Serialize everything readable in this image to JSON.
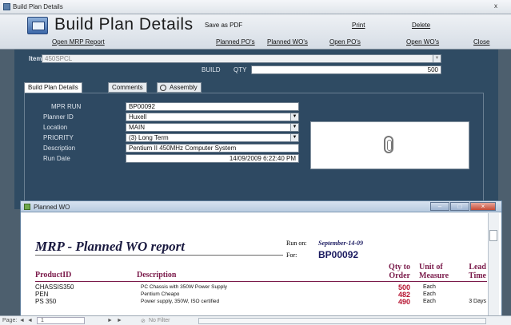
{
  "window": {
    "title": "Build Plan Details",
    "close_glyph": "x"
  },
  "header": {
    "title": "Build Plan Details",
    "top_buttons": [
      "Save as PDF",
      "Print",
      "Delete"
    ],
    "nav_buttons": [
      "Open MRP Report",
      "Planned PO's",
      "Planned WO's",
      "Open PO's",
      "Open WO's",
      "Close"
    ]
  },
  "form": {
    "item_label": "Item",
    "item_value": "450SPCL",
    "build_label": "BUILD",
    "qty_label": "QTY",
    "qty_value": "500",
    "tabs": [
      "Build Plan Details",
      "Comments",
      "Assembly"
    ],
    "fields": [
      {
        "label": "MPR RUN",
        "value": "BP00092",
        "dropdown": false
      },
      {
        "label": "Planner ID",
        "value": "Huxell",
        "dropdown": true
      },
      {
        "label": "Location",
        "value": "MAIN",
        "dropdown": true
      },
      {
        "label": "PRIORITY",
        "value": "(3) Long Term",
        "dropdown": true
      },
      {
        "label": "Description",
        "value": "Pentium II 450MHz Computer System",
        "dropdown": false
      },
      {
        "label": "Run Date",
        "value": "14/09/2009 6:22:40 PM",
        "dropdown": false
      }
    ]
  },
  "report_window": {
    "title": "Planned WO",
    "report_title": "MRP - Planned WO report",
    "run_on_label": "Run on:",
    "run_on_value": "September-14-09",
    "for_label": "For:",
    "for_value": "BP00092",
    "columns": {
      "product": "ProductID",
      "description": "Description",
      "qty1": "Qty to",
      "qty2": "Order",
      "uom1": "Unit of",
      "uom2": "Measure",
      "lead1": "Lead",
      "lead2": "Time"
    },
    "rows": [
      {
        "product": "CHASSIS350",
        "description": "PC Chassis with 350W Power Supply",
        "qty": "500",
        "uom": "Each",
        "lead": ""
      },
      {
        "product": "PEN",
        "description": "Pentium Cheapo",
        "qty": "482",
        "uom": "Each",
        "lead": ""
      },
      {
        "product": "PS 350",
        "description": "Power supply, 350W, ISO certified",
        "qty": "490",
        "uom": "Each",
        "lead": "3 Days"
      }
    ]
  },
  "statusbar": {
    "page_label": "Page:",
    "page_value": "1",
    "filter": "No Filter"
  },
  "colors": {
    "accent": "#2f4b63",
    "report_header": "#7a1a4a",
    "qty": "#b5102e"
  }
}
